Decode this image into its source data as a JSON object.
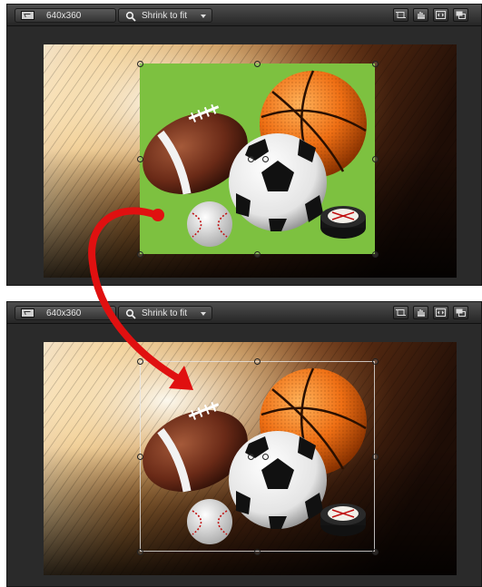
{
  "top_panel": {
    "resolution_label": "640x360",
    "fit_label": "Shrink to fit",
    "background_color": "#7dc140"
  },
  "bottom_panel": {
    "resolution_label": "640x360",
    "fit_label": "Shrink to fit"
  },
  "toolbar_icons": [
    "crop-icon",
    "move-icon",
    "fit-icon",
    "stretch-icon"
  ],
  "arrow_color": "#e01010",
  "objects": [
    "football",
    "basketball",
    "soccer-ball",
    "baseball",
    "hockey-puck"
  ]
}
